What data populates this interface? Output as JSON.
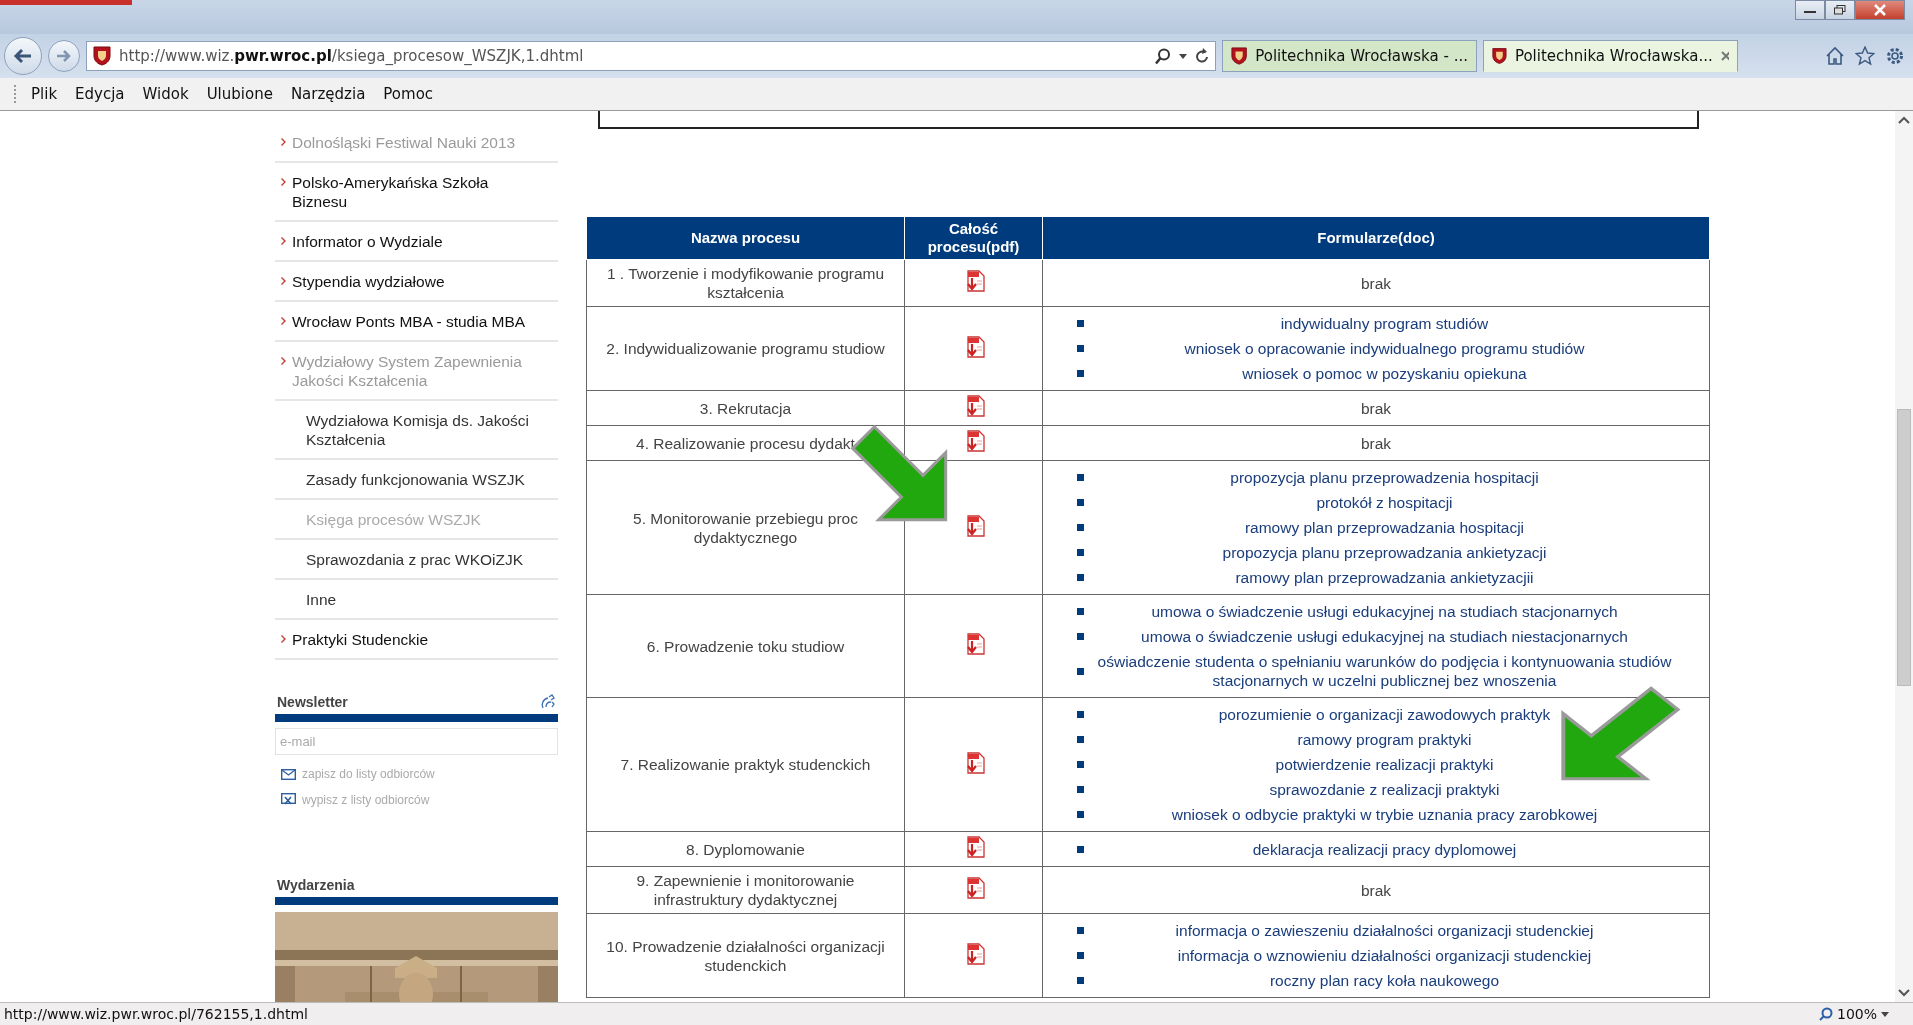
{
  "browser": {
    "address": "http://www.wiz.**pwr.wroc.pl**/ksiega_procesow_WSZJK,1.dhtml",
    "tabs": [
      {
        "label": "Politechnika Wrocławska - ...",
        "selected": false
      },
      {
        "label": "Politechnika Wrocławska...",
        "selected": true
      }
    ],
    "menu": [
      "Plik",
      "Edycja",
      "Widok",
      "Ulubione",
      "Narzędzia",
      "Pomoc"
    ]
  },
  "sidebar": {
    "items": [
      {
        "label": "Dolnośląski Festiwal Nauki 2013",
        "dimmed": true
      },
      {
        "label": "Polsko-Amerykańska Szkoła Biznesu",
        "dimmed": false
      },
      {
        "label": "Informator o Wydziale",
        "dimmed": false
      },
      {
        "label": "Stypendia wydziałowe",
        "dimmed": false
      },
      {
        "label": "Wrocław Ponts MBA - studia MBA",
        "dimmed": false
      },
      {
        "label": "Wydziałowy System Zapewnienia Jakości Kształcenia",
        "dimmed": true,
        "children": [
          {
            "label": "Wydziałowa Komisja ds. Jakości Kształcenia",
            "dimmed": false
          },
          {
            "label": "Zasady funkcjonowania WSZJK",
            "dimmed": false
          },
          {
            "label": "Księga procesów WSZJK",
            "dimmed": true
          },
          {
            "label": "Sprawozdania z prac WKOiZJK",
            "dimmed": false
          },
          {
            "label": "Inne",
            "dimmed": false
          }
        ]
      },
      {
        "label": "Praktyki Studenckie",
        "dimmed": false
      }
    ],
    "newsletter": {
      "title": "Newsletter",
      "placeholder": "e-mail",
      "links": [
        {
          "label": "zapisz do listy odbiorców",
          "kind": "subscribe"
        },
        {
          "label": "wypisz z listy odbiorców",
          "kind": "unsubscribe"
        }
      ]
    },
    "events": {
      "title": "Wydarzenia"
    }
  },
  "table": {
    "columns": [
      "Nazwa procesu",
      "Całość procesu(pdf)",
      "Formularze(doc)"
    ],
    "rows": [
      {
        "name": "1 . Tworzenie i modyfikowanie programu kształcenia",
        "kind": "none",
        "note": "brak"
      },
      {
        "name": "2. Indywidualizowanie programu studiow",
        "kind": "list",
        "forms": [
          "indywidualny program studiów",
          "wniosek o opracowanie indywidualnego programu studiów",
          "wniosek o pomoc w pozyskaniu opiekuna"
        ]
      },
      {
        "name": "3. Rekrutacja",
        "kind": "none",
        "note": "brak"
      },
      {
        "name": "4. Realizowanie procesu dydakt",
        "kind": "none",
        "note": "brak"
      },
      {
        "name": "5. Monitorowanie przebiegu proc\ndydaktycznego",
        "kind": "list",
        "forms": [
          "propozycja planu przeprowadzenia hospitacji",
          "protokół z hospitacji",
          "ramowy plan przeprowadzania hospitacji",
          "propozycja planu przeprowadzania ankietyzacji",
          "ramowy plan przeprowadzania ankietyzacjii"
        ]
      },
      {
        "name": "6. Prowadzenie toku studiow",
        "kind": "list",
        "forms": [
          "umowa o świadczenie usługi edukacyjnej na studiach stacjonarnych",
          "umowa o świadczenie usługi edukacyjnej na studiach niestacjonarnych",
          "oświadczenie studenta o spełnianiu warunków do podjęcia i kontynuowania studiów stacjonarnych w uczelni publicznej bez wnoszenia"
        ]
      },
      {
        "name": "7. Realizowanie praktyk studenckich",
        "kind": "list",
        "forms": [
          "porozumienie o organizacji zawodowych praktyk",
          "ramowy program praktyki",
          "potwierdzenie realizacji praktyki",
          "sprawozdanie z realizacji praktyki",
          "wniosek o odbycie praktyki w trybie uznania pracy zarobkowej"
        ]
      },
      {
        "name": "8. Dyplomowanie",
        "kind": "list",
        "forms": [
          "deklaracja realizacji pracy dyplomowej"
        ]
      },
      {
        "name": "9. Zapewnienie i monitorowanie infrastruktury dydaktycznej",
        "kind": "none",
        "note": "brak"
      },
      {
        "name": "10. Prowadzenie działalności organizacji studenckich",
        "kind": "list",
        "forms": [
          "informacja o zawieszeniu działalności organizacji studenckiej",
          "informacja o wznowieniu działalności organizacji studenckiej",
          "roczny plan racy koła naukowego"
        ]
      }
    ]
  },
  "status_bar": {
    "url": "http://www.wiz.pwr.wroc.pl/762155,1.dhtml",
    "zoom": "100%"
  }
}
